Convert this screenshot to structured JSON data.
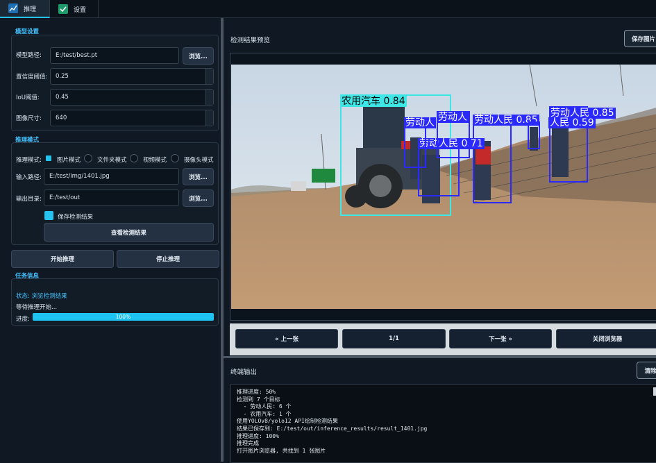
{
  "tabs": [
    {
      "label": "推理",
      "icon": "chart-icon"
    },
    {
      "label": "设置",
      "icon": "check-icon"
    }
  ],
  "model_settings": {
    "title": "模型设置",
    "model_path_label": "模型路径:",
    "model_path_value": "E:/test/best.pt",
    "browse_label": "浏览...",
    "conf_label": "置信度阈值:",
    "conf_value": "0.25",
    "iou_label": "IoU阈值:",
    "iou_value": "0.45",
    "imgsize_label": "图像尺寸:",
    "imgsize_value": "640"
  },
  "inference_mode": {
    "title": "推理模式",
    "mode_label": "推理模式:",
    "options": [
      "图片模式",
      "文件夹模式",
      "视频模式",
      "摄像头模式"
    ],
    "selected": "图片模式",
    "input_label": "输入路径:",
    "input_value": "E:/test/img/1401.jpg",
    "output_label": "输出目录:",
    "output_value": "E:/test/out",
    "browse_label": "浏览...",
    "save_results_label": "保存检测结果",
    "view_results_label": "查看检测结果"
  },
  "actions": {
    "start_label": "开始推理",
    "stop_label": "停止推理"
  },
  "task_info": {
    "title": "任务信息",
    "status": "状态: 浏览检测结果",
    "waiting": "等待推理开始...",
    "progress_label": "进度:",
    "progress_value": 100,
    "progress_text": "100%"
  },
  "preview": {
    "title": "检测结果预览",
    "save_button": "保存图片",
    "detections": [
      {
        "label": "农用汽车 0.84",
        "color": "#3ee6e6"
      },
      {
        "label": "劳动人民 0.85",
        "color": "#2a2aff"
      },
      {
        "label": "劳动人民 0.85",
        "color": "#2a2aff"
      },
      {
        "label": "劳动人民 0.71",
        "color": "#2a2aff"
      },
      {
        "label": "劳动人",
        "color": "#2a2aff"
      },
      {
        "label": "劳动人",
        "color": "#2a2aff"
      },
      {
        "label": "人民 0.59",
        "color": "#2a2aff"
      }
    ],
    "prev_label": "« 上一张",
    "counter": "1/1",
    "next_label": "下一张 »",
    "close_label": "关闭浏览器"
  },
  "terminal": {
    "title": "终端输出",
    "clear_button": "清除",
    "lines": [
      "推理进度: 50%",
      "检测到 7 个目标",
      "  - 劳动人民: 6 个",
      "  - 农用汽车: 1 个",
      "使用YOLOv8/yolo12 API绘制检测结果",
      "结果已保存到: E:/test/out/inference_results/result_1401.jpg",
      "推理进度: 100%",
      "推理完成",
      "打开图片浏览器, 共找到 1 张图片"
    ]
  },
  "colors": {
    "accent": "#25c3ee",
    "background": "#0f1823",
    "panel": "#121c27"
  }
}
